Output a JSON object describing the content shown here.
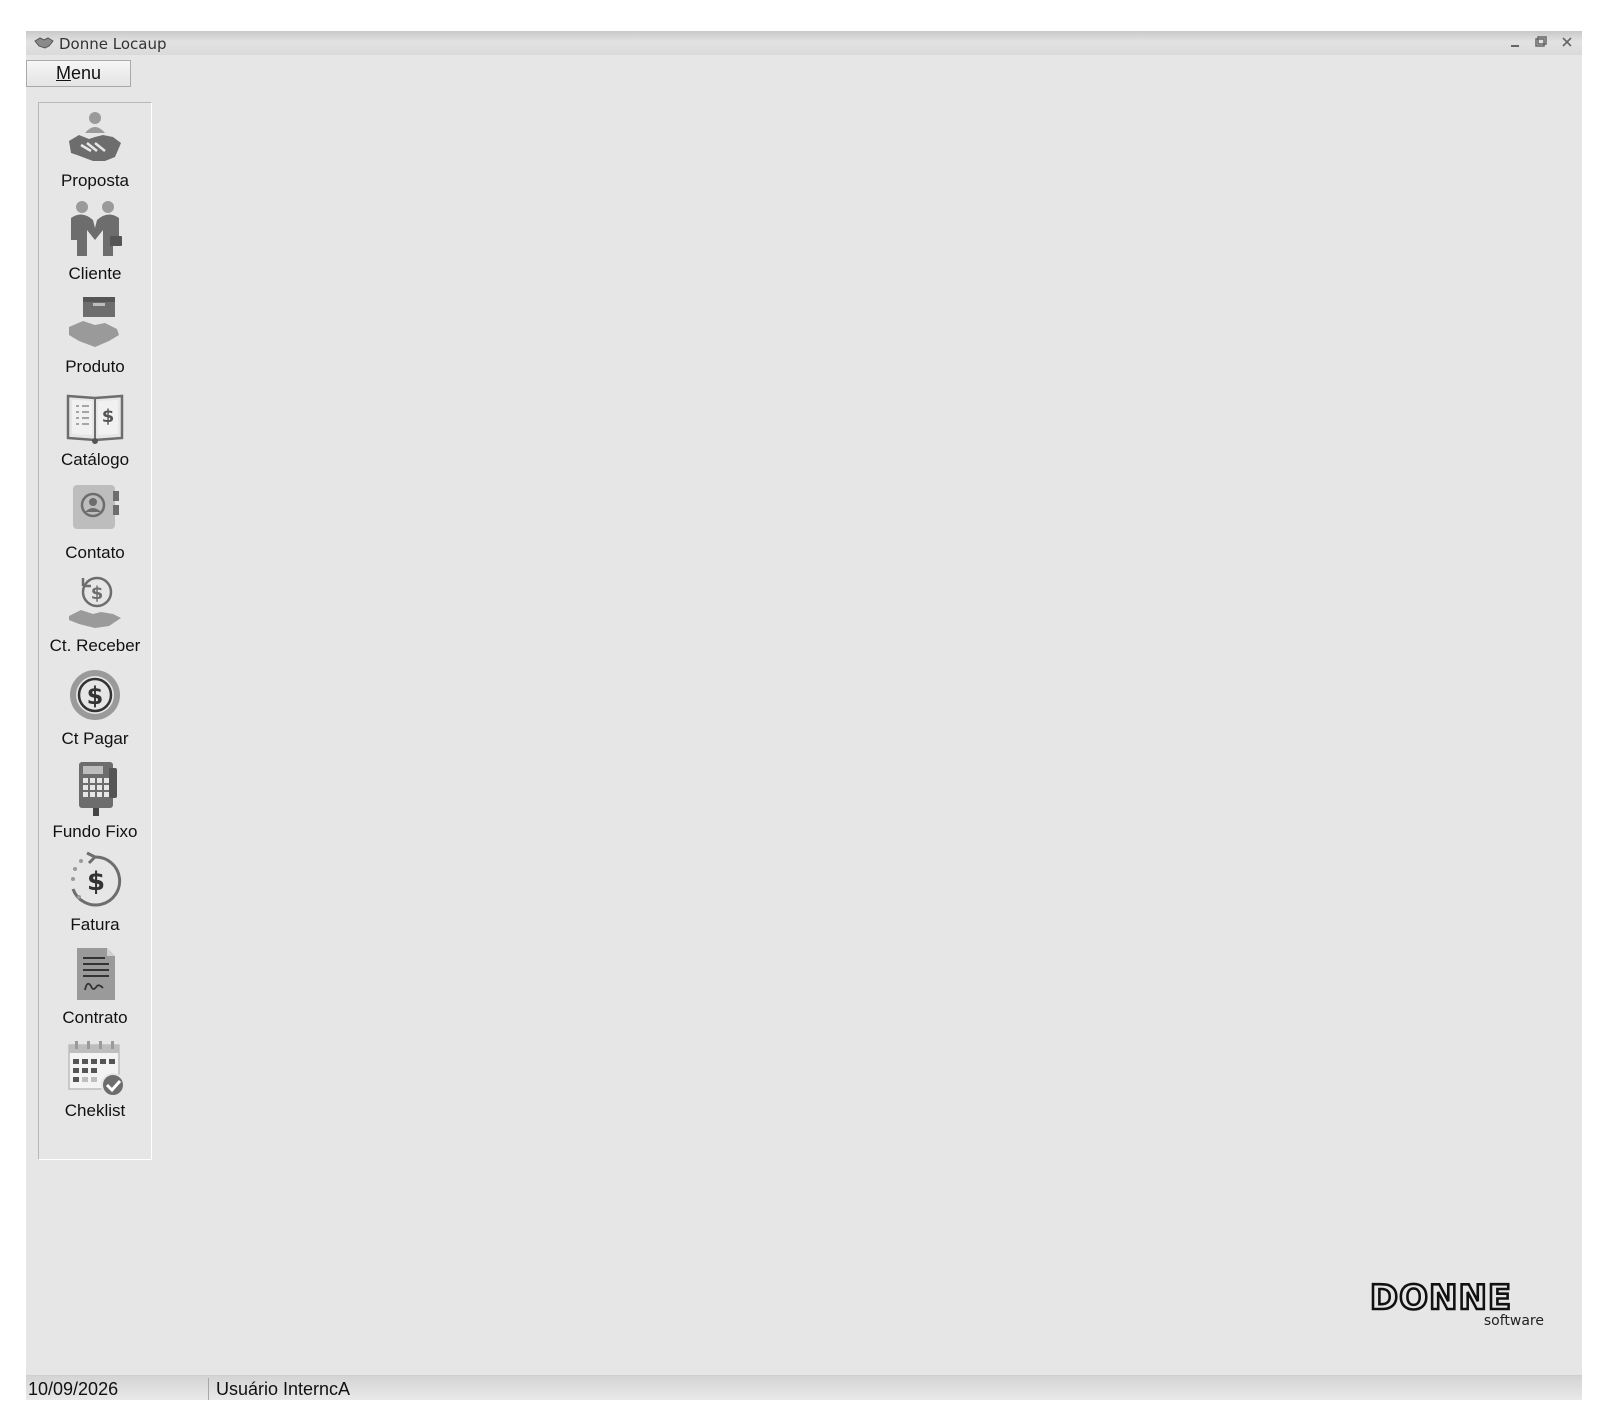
{
  "window": {
    "title": "Donne Locaup"
  },
  "menu": {
    "label_accel": "M",
    "label_rest": "enu"
  },
  "sidebar": {
    "items": [
      {
        "label": "Proposta",
        "icon": "handshake-icon"
      },
      {
        "label": "Cliente",
        "icon": "people-icon"
      },
      {
        "label": "Produto",
        "icon": "package-hand-icon"
      },
      {
        "label": "Catálogo",
        "icon": "catalog-book-icon"
      },
      {
        "label": "Contato",
        "icon": "contact-book-icon"
      },
      {
        "label": "Ct. Receber",
        "icon": "money-receive-icon"
      },
      {
        "label": "Ct Pagar",
        "icon": "dollar-coin-icon"
      },
      {
        "label": "Fundo Fixo",
        "icon": "calculator-icon"
      },
      {
        "label": "Fatura",
        "icon": "dollar-refresh-icon"
      },
      {
        "label": "Contrato",
        "icon": "contract-document-icon"
      },
      {
        "label": "Cheklist",
        "icon": "calendar-check-icon"
      }
    ]
  },
  "logo": {
    "brand": "DONNE",
    "sub": "software"
  },
  "statusbar": {
    "date": "10/09/2026",
    "user": "Usuário InterncA"
  },
  "colors": {
    "background": "#e6e6e6",
    "icon": "#6d6d6d",
    "icon_light": "#9a9a9a"
  }
}
